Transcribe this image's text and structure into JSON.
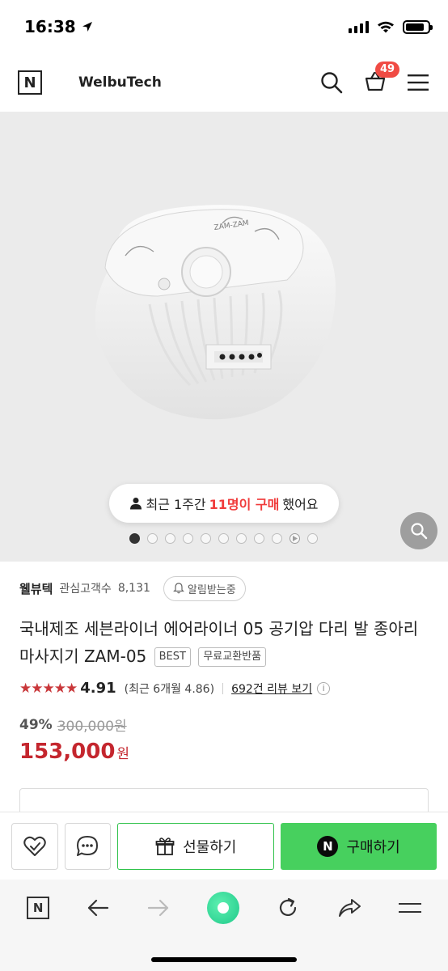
{
  "status_bar": {
    "time": "16:38"
  },
  "header": {
    "store_name": "WelbuTech",
    "logo_letter": "N",
    "cart_count": "49"
  },
  "hero": {
    "purchase_notice_prefix": "최근 1주간",
    "purchase_notice_highlight": "11명이 구매",
    "purchase_notice_suffix": "했어요",
    "slide_count": 11,
    "active_slide": 0,
    "device_panel_text": "ZAM-ZAM"
  },
  "seller": {
    "name": "웰뷰텍",
    "interest_label": "관심고객수",
    "interest_count": "8,131",
    "alarm_label": "알림받는중"
  },
  "product": {
    "title": "국내제조 세븐라이너 에어라이너 05 공기압 다리 발 종아리마사지기 ZAM-05",
    "tags": [
      "BEST",
      "무료교환반품"
    ]
  },
  "rating": {
    "stars": "★★★★★",
    "score": "4.91",
    "recent": "(최근 6개월 4.86)",
    "review_link": "692건 리뷰 보기",
    "info_icon": "i"
  },
  "price": {
    "discount_percent": "49%",
    "original": "300,000원",
    "sale": "153,000",
    "currency": "원"
  },
  "actions": {
    "gift_label": "선물하기",
    "buy_label": "구매하기",
    "buy_logo": "N"
  },
  "browser": {
    "logo_letter": "N"
  },
  "colors": {
    "brand_green": "#47d05e",
    "price_red": "#c4262e",
    "badge_red": "#f04b44",
    "highlight_red": "#f03c3c"
  }
}
